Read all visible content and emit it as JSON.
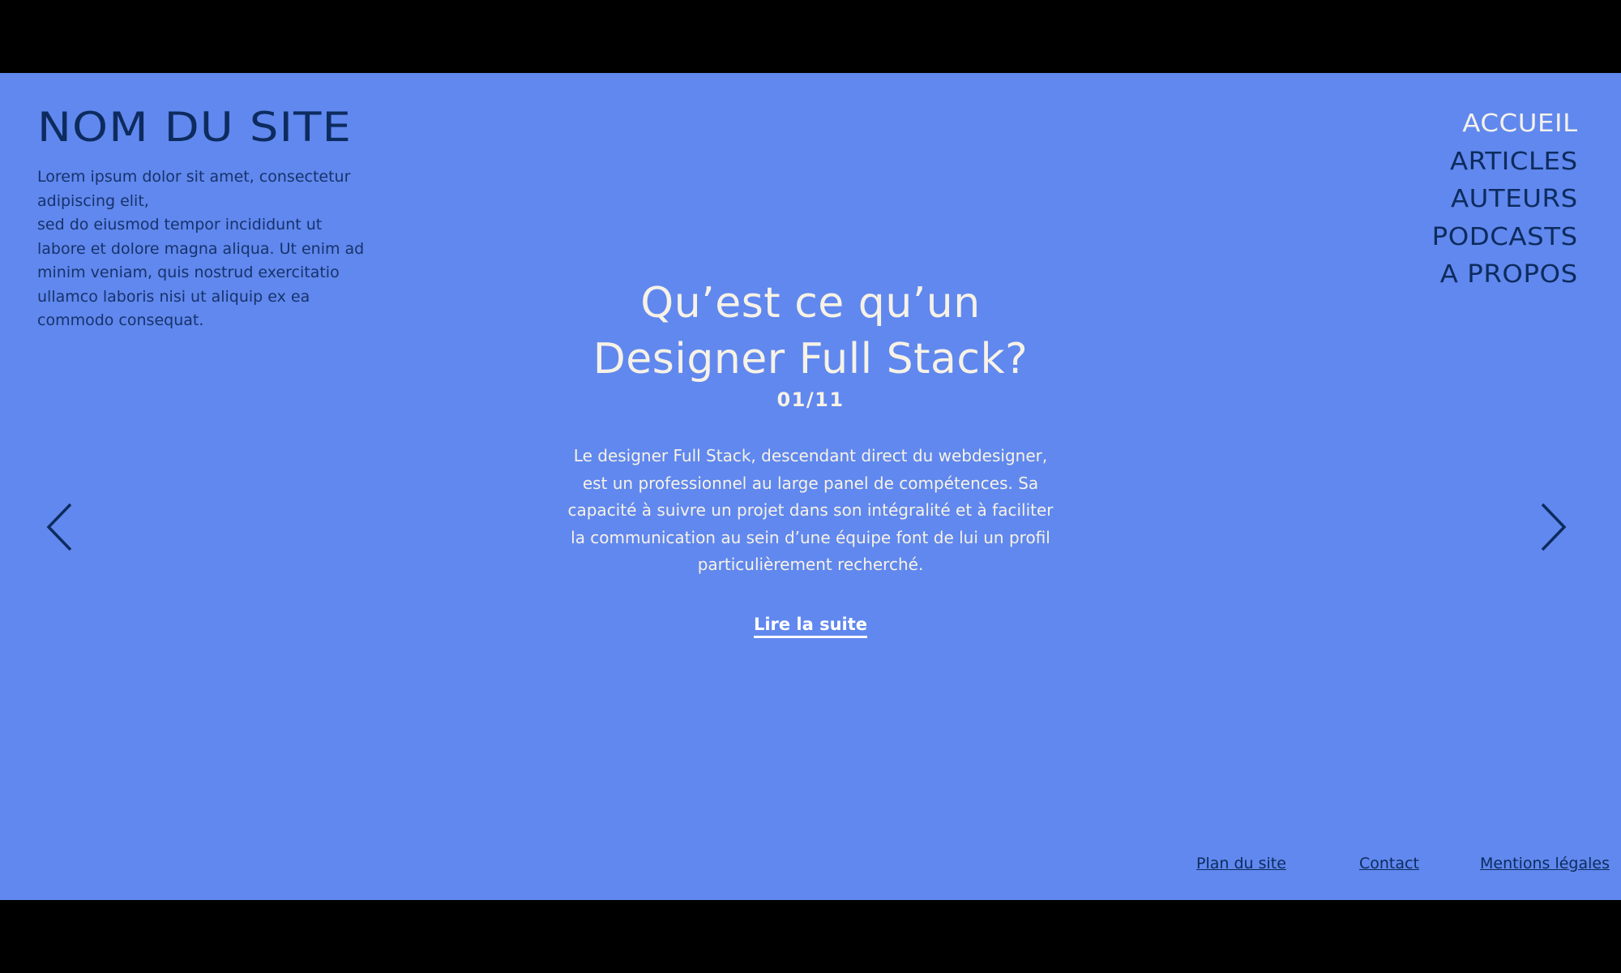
{
  "header": {
    "site_title": "NOM DU SITE",
    "description_lines": [
      "Lorem ipsum dolor sit amet, consectetur",
      "adipiscing elit,",
      "sed do eiusmod tempor incididunt ut",
      "labore et dolore magna aliqua. Ut enim ad",
      "minim veniam, quis nostrud exercitatio",
      "ullamco laboris nisi ut aliquip ex ea",
      "commodo consequat."
    ]
  },
  "nav": {
    "items": [
      {
        "label": "ACCUEIL",
        "active": true
      },
      {
        "label": "ARTICLES",
        "active": false
      },
      {
        "label": "AUTEURS",
        "active": false
      },
      {
        "label": "PODCASTS",
        "active": false
      },
      {
        "label": "A PROPOS",
        "active": false
      }
    ]
  },
  "slide": {
    "title_lines": [
      "Qu’est ce qu’un",
      "Designer Full Stack?"
    ],
    "counter": "01/11",
    "text_lines": [
      "Le designer Full Stack, descendant direct du webdesigner,",
      "est un professionnel au large panel de compétences. Sa",
      "capacité à suivre un projet dans son intégralité et à faciliter",
      "la communication au sein d’une équipe font de lui un profil",
      "particulièrement recherché."
    ],
    "read_more": "Lire la suite"
  },
  "carousel": {
    "prev_icon": "chevron-left-icon",
    "next_icon": "chevron-right-icon"
  },
  "footer": {
    "plan": "Plan du site",
    "contact": "Contact",
    "legal": "Mentions légales"
  },
  "colors": {
    "background": "#6088ee",
    "dark_text": "#0d2b5e",
    "light_text": "#f7f2e6",
    "letterbox": "#000000"
  }
}
